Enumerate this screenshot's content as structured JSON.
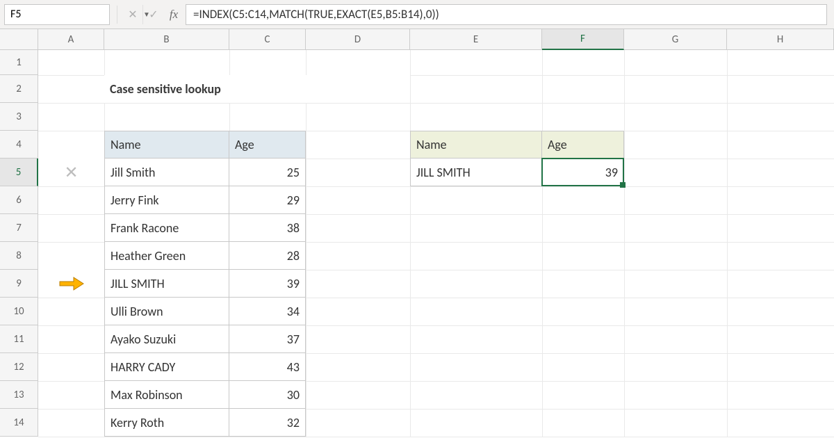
{
  "formula_bar": {
    "cell_ref": "F5",
    "formula": "=INDEX(C5:C14,MATCH(TRUE,EXACT(E5,B5:B14),0))"
  },
  "columns": {
    "A": 95,
    "B": 180,
    "C": 110,
    "D": 150,
    "E": 190,
    "F": 118,
    "G": 148,
    "H": 154
  },
  "row_heights": {
    "1": 36,
    "other": 40
  },
  "title": "Case sensitive lookup",
  "main_table": {
    "headers": {
      "name": "Name",
      "age": "Age"
    },
    "rows": [
      {
        "name": "Jill Smith",
        "age": 25,
        "x": true
      },
      {
        "name": "Jerry Fink",
        "age": 29
      },
      {
        "name": "Frank Racone",
        "age": 38
      },
      {
        "name": "Heather Green",
        "age": 28
      },
      {
        "name": "JILL SMITH",
        "age": 39,
        "arrow": true
      },
      {
        "name": "Ulli Brown",
        "age": 34
      },
      {
        "name": "Ayako Suzuki",
        "age": 37
      },
      {
        "name": "HARRY CADY",
        "age": 43
      },
      {
        "name": "Max Robinson",
        "age": 30
      },
      {
        "name": "Kerry Roth",
        "age": 32
      }
    ]
  },
  "lookup_table": {
    "headers": {
      "name": "Name",
      "age": "Age"
    },
    "row": {
      "name": "JILL SMITH",
      "age": 39
    }
  },
  "selected": {
    "col": "F",
    "row": 5
  }
}
